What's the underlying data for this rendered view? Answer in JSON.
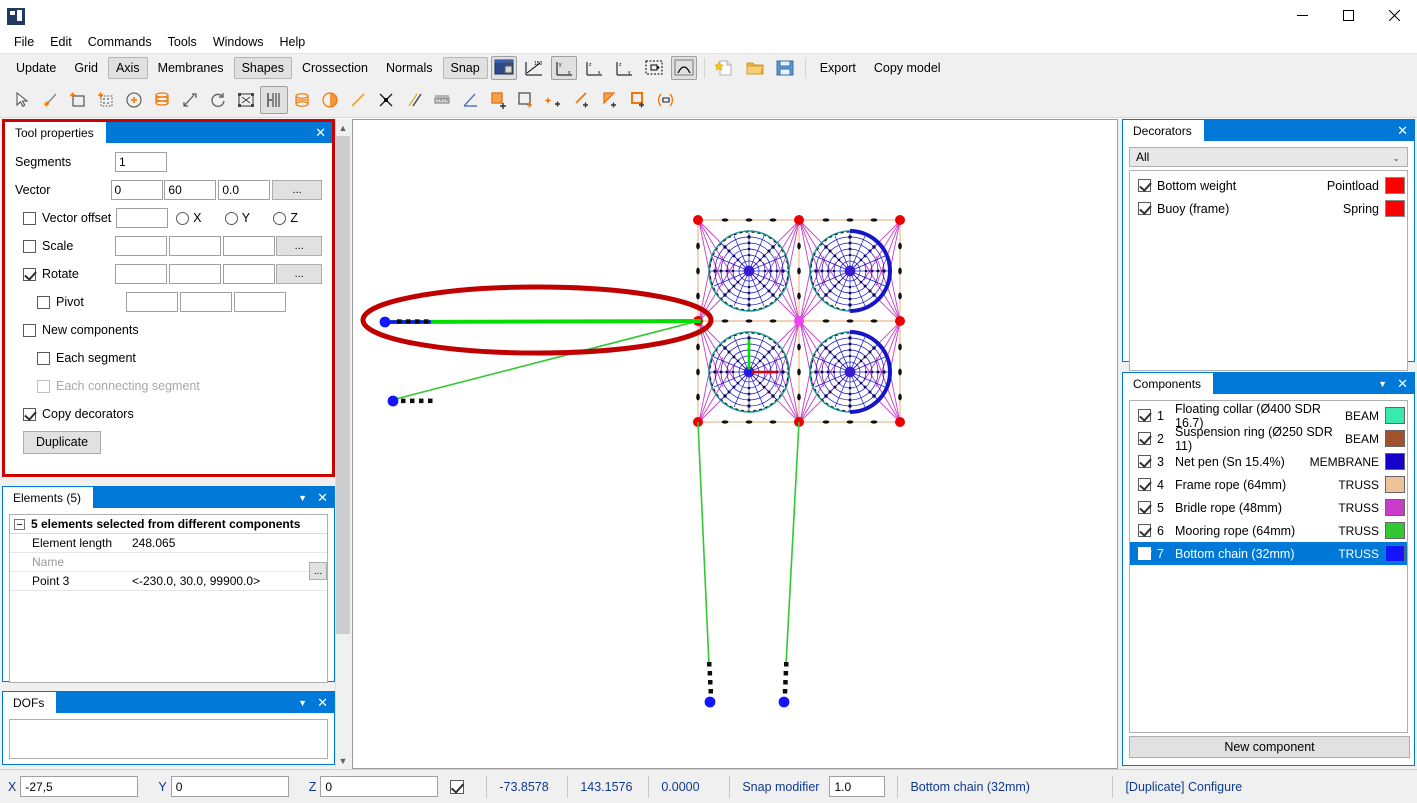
{
  "window": {
    "app_icon": "app-icon",
    "minimize": "minimize-icon",
    "maximize": "maximize-icon",
    "close": "close-icon"
  },
  "menubar": {
    "items": [
      "File",
      "Edit",
      "Commands",
      "Tools",
      "Windows",
      "Help"
    ]
  },
  "toolbar_top": {
    "text_buttons": [
      {
        "label": "Update",
        "pressed": false
      },
      {
        "label": "Grid",
        "pressed": false
      },
      {
        "label": "Axis",
        "pressed": true
      },
      {
        "label": "Membranes",
        "pressed": false
      },
      {
        "label": "Shapes",
        "pressed": true
      },
      {
        "label": "Crossection",
        "pressed": false
      },
      {
        "label": "Normals",
        "pressed": false
      },
      {
        "label": "Snap",
        "pressed": true
      }
    ],
    "icons": [
      {
        "name": "lock-view-icon",
        "pressed": true
      },
      {
        "name": "rotate-150-icon",
        "pressed": false
      },
      {
        "name": "axis-yx-icon",
        "pressed": true
      },
      {
        "name": "axis-zx-icon",
        "pressed": false
      },
      {
        "name": "axis-zy-icon",
        "pressed": false
      },
      {
        "name": "zoom-extents-icon",
        "pressed": false
      },
      {
        "name": "perspective-icon",
        "pressed": true
      },
      {
        "name": "new-file-icon",
        "pressed": false
      },
      {
        "name": "open-folder-icon",
        "pressed": false
      },
      {
        "name": "save-disk-icon",
        "pressed": false
      }
    ],
    "export_label": "Export",
    "copy_model_label": "Copy model"
  },
  "toolbar_tools": {
    "icons": [
      {
        "name": "select-arrow-icon",
        "pressed": false
      },
      {
        "name": "add-line-icon",
        "pressed": false
      },
      {
        "name": "add-rectangle-icon",
        "pressed": false
      },
      {
        "name": "add-grid-icon",
        "pressed": false
      },
      {
        "name": "add-point-icon",
        "pressed": false
      },
      {
        "name": "cylinder-icon",
        "pressed": false
      },
      {
        "name": "extrude-icon",
        "pressed": false
      },
      {
        "name": "rotate-icon",
        "pressed": false
      },
      {
        "name": "scale-icon",
        "pressed": false
      },
      {
        "name": "duplicate-array-icon",
        "pressed": true
      },
      {
        "name": "revolve-icon",
        "pressed": false
      },
      {
        "name": "half-sphere-icon",
        "pressed": false
      },
      {
        "name": "line-segment-icon",
        "pressed": false
      },
      {
        "name": "intersect-icon",
        "pressed": false
      },
      {
        "name": "parallel-icon",
        "pressed": false
      },
      {
        "name": "measure-icon",
        "pressed": false
      },
      {
        "name": "angle-icon",
        "pressed": false
      },
      {
        "name": "add-surface-icon",
        "pressed": false
      },
      {
        "name": "add-face-icon",
        "pressed": false
      },
      {
        "name": "add-node-icon",
        "pressed": false
      },
      {
        "name": "add-edge-icon",
        "pressed": false
      },
      {
        "name": "add-triangle-icon",
        "pressed": false
      },
      {
        "name": "add-quad-icon",
        "pressed": false
      },
      {
        "name": "mirror-icon",
        "pressed": false
      }
    ]
  },
  "tool_properties": {
    "title": "Tool properties",
    "segments_label": "Segments",
    "segments_value": "1",
    "vector_label": "Vector",
    "vector_x": "0",
    "vector_y": "60",
    "vector_z": "0.0",
    "dots_label": "...",
    "vector_offset_label": "Vector offset",
    "vector_offset_checked": false,
    "vector_offset_value": "",
    "axis_x_label": "X",
    "axis_y_label": "Y",
    "axis_z_label": "Z",
    "scale_label": "Scale",
    "scale_checked": false,
    "scale_x": "",
    "scale_y": "",
    "scale_z": "",
    "rotate_label": "Rotate",
    "rotate_checked": true,
    "rotate_x": "",
    "rotate_y": "",
    "rotate_z": "",
    "pivot_label": "Pivot",
    "pivot_checked": false,
    "pivot_x": "",
    "pivot_y": "",
    "pivot_z": "",
    "new_components_label": "New components",
    "new_components_checked": false,
    "each_segment_label": "Each segment",
    "each_segment_checked": false,
    "each_connecting_segment_label": "Each connecting segment",
    "each_connecting_segment_checked": false,
    "each_connecting_segment_disabled": true,
    "copy_decorators_label": "Copy decorators",
    "copy_decorators_checked": true,
    "duplicate_button": "Duplicate",
    "highlight_color": "#cc0000"
  },
  "elements": {
    "title": "Elements (5)",
    "group_header": "5 elements selected from different components",
    "rows": [
      {
        "key": "Element length",
        "value": "248.065",
        "greyed": false,
        "has_dots": false
      },
      {
        "key": "Name",
        "value": "",
        "greyed": true,
        "has_dots": true
      },
      {
        "key": "Point 3",
        "value": "<-230.0, 30.0, 99900.0>",
        "greyed": false,
        "has_dots": false
      }
    ],
    "dots_label": "..."
  },
  "dofs": {
    "title": "DOFs"
  },
  "decorators": {
    "title": "Decorators",
    "filter_value": "All",
    "items": [
      {
        "name": "Bottom weight",
        "type": "Pointload",
        "checked": true,
        "color": "#ff0000"
      },
      {
        "name": "Buoy (frame)",
        "type": "Spring",
        "checked": true,
        "color": "#ff0000"
      }
    ]
  },
  "components": {
    "title": "Components",
    "items": [
      {
        "num": "1",
        "name": "Floating collar (Ø400 SDR 16.7)",
        "type": "BEAM",
        "checked": true,
        "color": "#3ae8b0",
        "selected": false
      },
      {
        "num": "2",
        "name": "Suspension ring (Ø250 SDR 11)",
        "type": "BEAM",
        "checked": true,
        "color": "#a0522d",
        "selected": false
      },
      {
        "num": "3",
        "name": "Net pen (Sn 15.4%)",
        "type": "MEMBRANE",
        "checked": true,
        "color": "#1400c8",
        "selected": false
      },
      {
        "num": "4",
        "name": "Frame rope (64mm)",
        "type": "TRUSS",
        "checked": true,
        "color": "#eec39a",
        "selected": false
      },
      {
        "num": "5",
        "name": "Bridle rope (48mm)",
        "type": "TRUSS",
        "checked": true,
        "color": "#c83cc8",
        "selected": false
      },
      {
        "num": "6",
        "name": "Mooring rope (64mm)",
        "type": "TRUSS",
        "checked": true,
        "color": "#32c832",
        "selected": false
      },
      {
        "num": "7",
        "name": "Bottom chain (32mm)",
        "type": "TRUSS",
        "checked": true,
        "color": "#1414ff",
        "selected": true
      }
    ],
    "new_component_button": "New component"
  },
  "statusbar": {
    "x_label": "X",
    "x_value": "-27,5",
    "y_label": "Y",
    "y_value": "0",
    "z_label": "Z",
    "z_value": "0",
    "lock_checked": true,
    "coord1": "-73.8578",
    "coord2": "143.1576",
    "coord3": "0.0000",
    "snap_modifier_label": "Snap modifier",
    "snap_modifier_value": "1.0",
    "active_component": "Bottom chain (32mm)",
    "command_status": "[Duplicate] Configure"
  },
  "viewport": {
    "name": "3d-model-viewport",
    "highlight_ellipse_color": "#c00000",
    "selected_element_color": "#00e000"
  }
}
